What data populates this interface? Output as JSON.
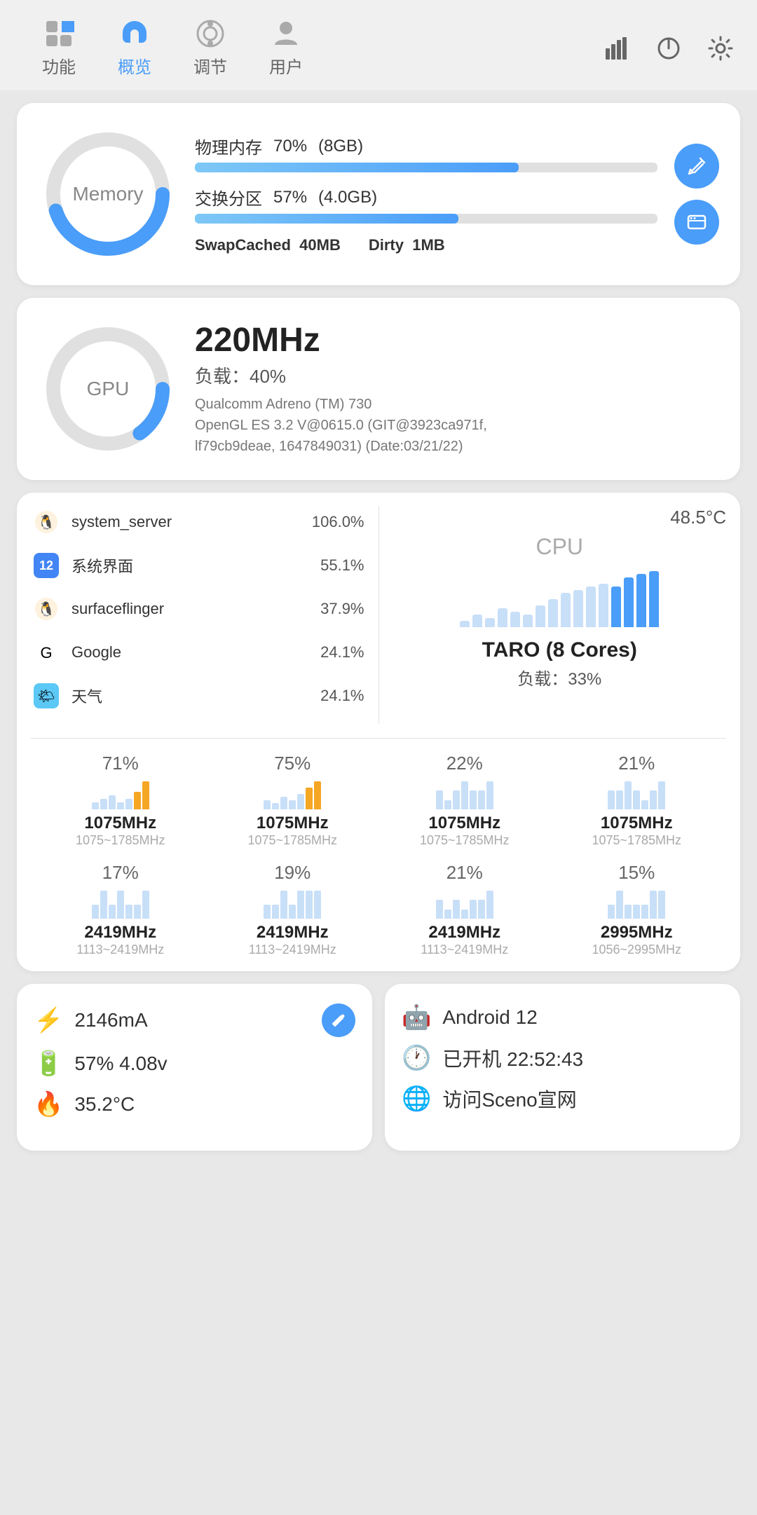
{
  "nav": {
    "items": [
      {
        "id": "features",
        "label": "功能",
        "active": false
      },
      {
        "id": "overview",
        "label": "概览",
        "active": true
      },
      {
        "id": "tune",
        "label": "调节",
        "active": false
      },
      {
        "id": "user",
        "label": "用户",
        "active": false
      }
    ],
    "right_icons": [
      "chart-icon",
      "power-icon",
      "settings-icon"
    ]
  },
  "memory": {
    "label": "Memory",
    "physical_title": "物理内存",
    "physical_pct": "70%",
    "physical_size": "(8GB)",
    "physical_fill": 70,
    "swap_title": "交换分区",
    "swap_pct": "57%",
    "swap_size": "(4.0GB)",
    "swap_fill": 57,
    "swap_cached_label": "SwapCached",
    "swap_cached_value": "40MB",
    "dirty_label": "Dirty",
    "dirty_value": "1MB",
    "btn1_icon": "clean-icon",
    "btn2_icon": "storage-icon"
  },
  "gpu": {
    "label": "GPU",
    "freq": "220MHz",
    "load_label": "负载：",
    "load_value": "40%",
    "detail_line1": "Qualcomm Adreno (TM) 730",
    "detail_line2": "OpenGL ES 3.2 V@0615.0 (GIT@3923ca971f,",
    "detail_line3": "lf79cb9deae, 1647849031) (Date:03/21/22)"
  },
  "cpu": {
    "label": "CPU",
    "chip": "TARO (8 Cores)",
    "load_label": "负载：",
    "load_value": "33%",
    "temp": "48.5°C",
    "processes": [
      {
        "name": "system_server",
        "pct": "106.0%",
        "icon_type": "linux"
      },
      {
        "name": "系统界面",
        "pct": "55.1%",
        "icon_type": "android12"
      },
      {
        "name": "surfaceflinger",
        "pct": "37.9%",
        "icon_type": "linux"
      },
      {
        "name": "Google",
        "pct": "24.1%",
        "icon_type": "google"
      },
      {
        "name": "天气",
        "pct": "24.1%",
        "icon_type": "weather"
      }
    ],
    "chart_bars": [
      10,
      20,
      15,
      30,
      25,
      20,
      35,
      45,
      55,
      60,
      65,
      70,
      65,
      80,
      85,
      90
    ],
    "cores": [
      {
        "pct": "71%",
        "freq": "1075MHz",
        "range": "1075~1785MHz",
        "bars": [
          2,
          3,
          4,
          2,
          3,
          5,
          8
        ],
        "highlight": true
      },
      {
        "pct": "75%",
        "freq": "1075MHz",
        "range": "1075~1785MHz",
        "bars": [
          3,
          2,
          4,
          3,
          5,
          7,
          9
        ],
        "highlight": true
      },
      {
        "pct": "22%",
        "freq": "1075MHz",
        "range": "1075~1785MHz",
        "bars": [
          2,
          1,
          2,
          3,
          2,
          2,
          3
        ],
        "highlight": false
      },
      {
        "pct": "21%",
        "freq": "1075MHz",
        "range": "1075~1785MHz",
        "bars": [
          2,
          2,
          3,
          2,
          1,
          2,
          3
        ],
        "highlight": false
      },
      {
        "pct": "17%",
        "freq": "2419MHz",
        "range": "1113~2419MHz",
        "bars": [
          1,
          2,
          1,
          2,
          1,
          1,
          2
        ],
        "highlight": false
      },
      {
        "pct": "19%",
        "freq": "2419MHz",
        "range": "1113~2419MHz",
        "bars": [
          1,
          1,
          2,
          1,
          2,
          2,
          2
        ],
        "highlight": false
      },
      {
        "pct": "21%",
        "freq": "2419MHz",
        "range": "1113~2419MHz",
        "bars": [
          2,
          1,
          2,
          1,
          2,
          2,
          3
        ],
        "highlight": false
      },
      {
        "pct": "15%",
        "freq": "2995MHz",
        "range": "1056~2995MHz",
        "bars": [
          1,
          2,
          1,
          1,
          1,
          2,
          2
        ],
        "highlight": false
      }
    ]
  },
  "bottom_left": {
    "rows": [
      {
        "icon": "plug-icon",
        "value": "2146mA",
        "has_edit": true
      },
      {
        "icon": "battery-icon",
        "value": "57%  4.08v",
        "has_edit": false
      },
      {
        "icon": "temp-icon",
        "value": "35.2°C",
        "has_edit": false
      }
    ]
  },
  "bottom_right": {
    "rows": [
      {
        "icon": "android-icon",
        "value": "Android 12"
      },
      {
        "icon": "clock-icon",
        "value": "已开机 22:52:43"
      },
      {
        "icon": "visit-icon",
        "value": "访问Sceno宣网"
      }
    ]
  },
  "colors": {
    "blue": "#4a9df8",
    "blue_light": "#a8d4fc",
    "orange": "#f5a623",
    "orange_light": "#fad5a0",
    "gray_bar": "#c8dff8"
  }
}
